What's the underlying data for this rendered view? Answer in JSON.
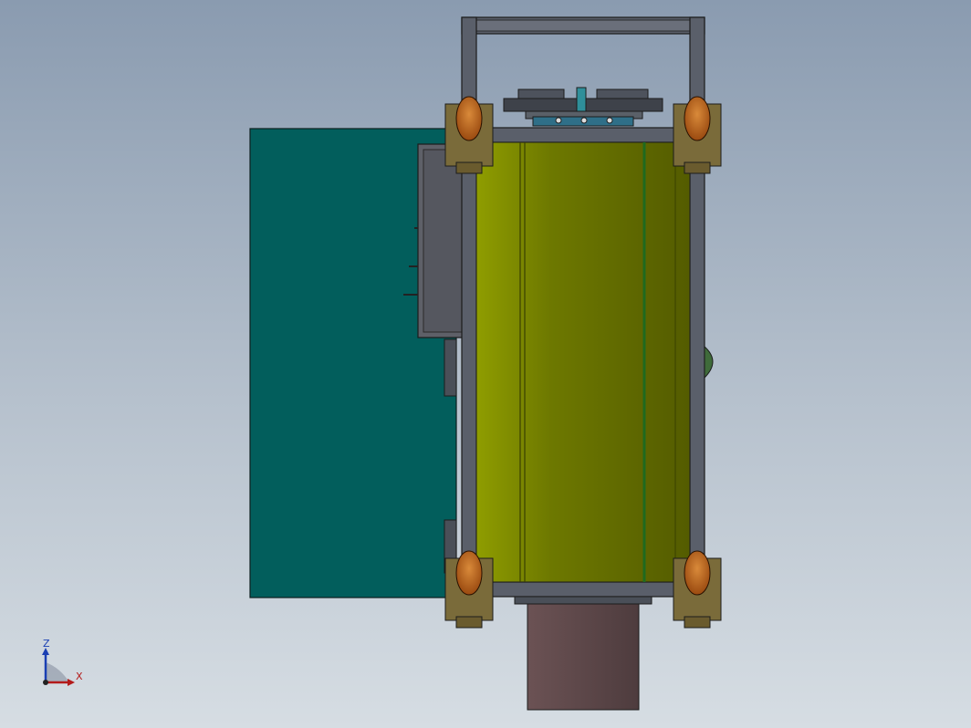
{
  "viewport": {
    "background_top": "#8a9bb0",
    "background_bottom": "#d6dde3"
  },
  "colors": {
    "frame": "#5a5f6a",
    "frame_edge": "#1c1c1c",
    "cabinet": "#025e5c",
    "drum_light": "#8c9a00",
    "drum_dark": "#5a6200",
    "chute": "#5c4648",
    "caster_wheel": "#c0621e",
    "caster_bracket": "#7a6b3a",
    "gear_hub": "#2f8f9a",
    "knob": "#3f6b3a"
  },
  "axis_triad": {
    "z_label": "Z",
    "x_label": "X",
    "z_color": "#1a3fb3",
    "x_color": "#b31a1a"
  }
}
